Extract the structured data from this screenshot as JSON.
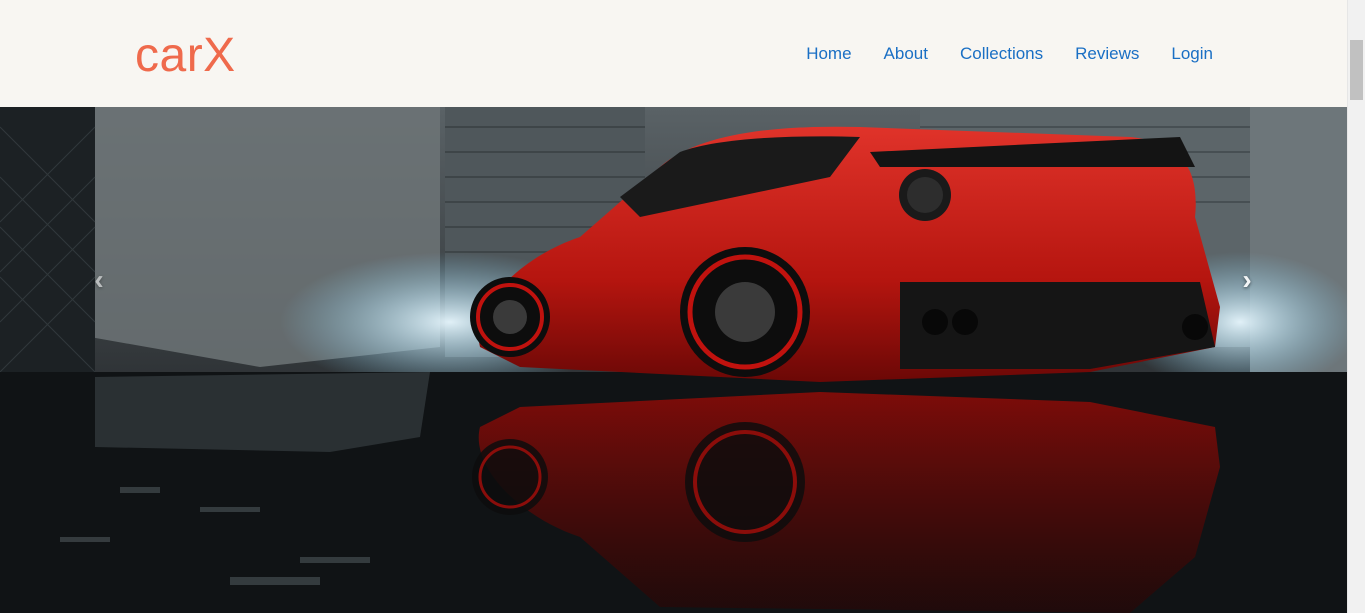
{
  "brand": {
    "name": "carX",
    "color": "#ef6a4c"
  },
  "nav": {
    "items": [
      {
        "label": "Home"
      },
      {
        "label": "About"
      },
      {
        "label": "Collections"
      },
      {
        "label": "Reviews"
      },
      {
        "label": "Login"
      }
    ],
    "link_color": "#1a6fc4"
  },
  "carousel": {
    "slide_image": "red-sports-car-in-garage",
    "prev_icon": "chevron-left",
    "next_icon": "chevron-right",
    "prev_glyph": "‹",
    "next_glyph": "›"
  }
}
